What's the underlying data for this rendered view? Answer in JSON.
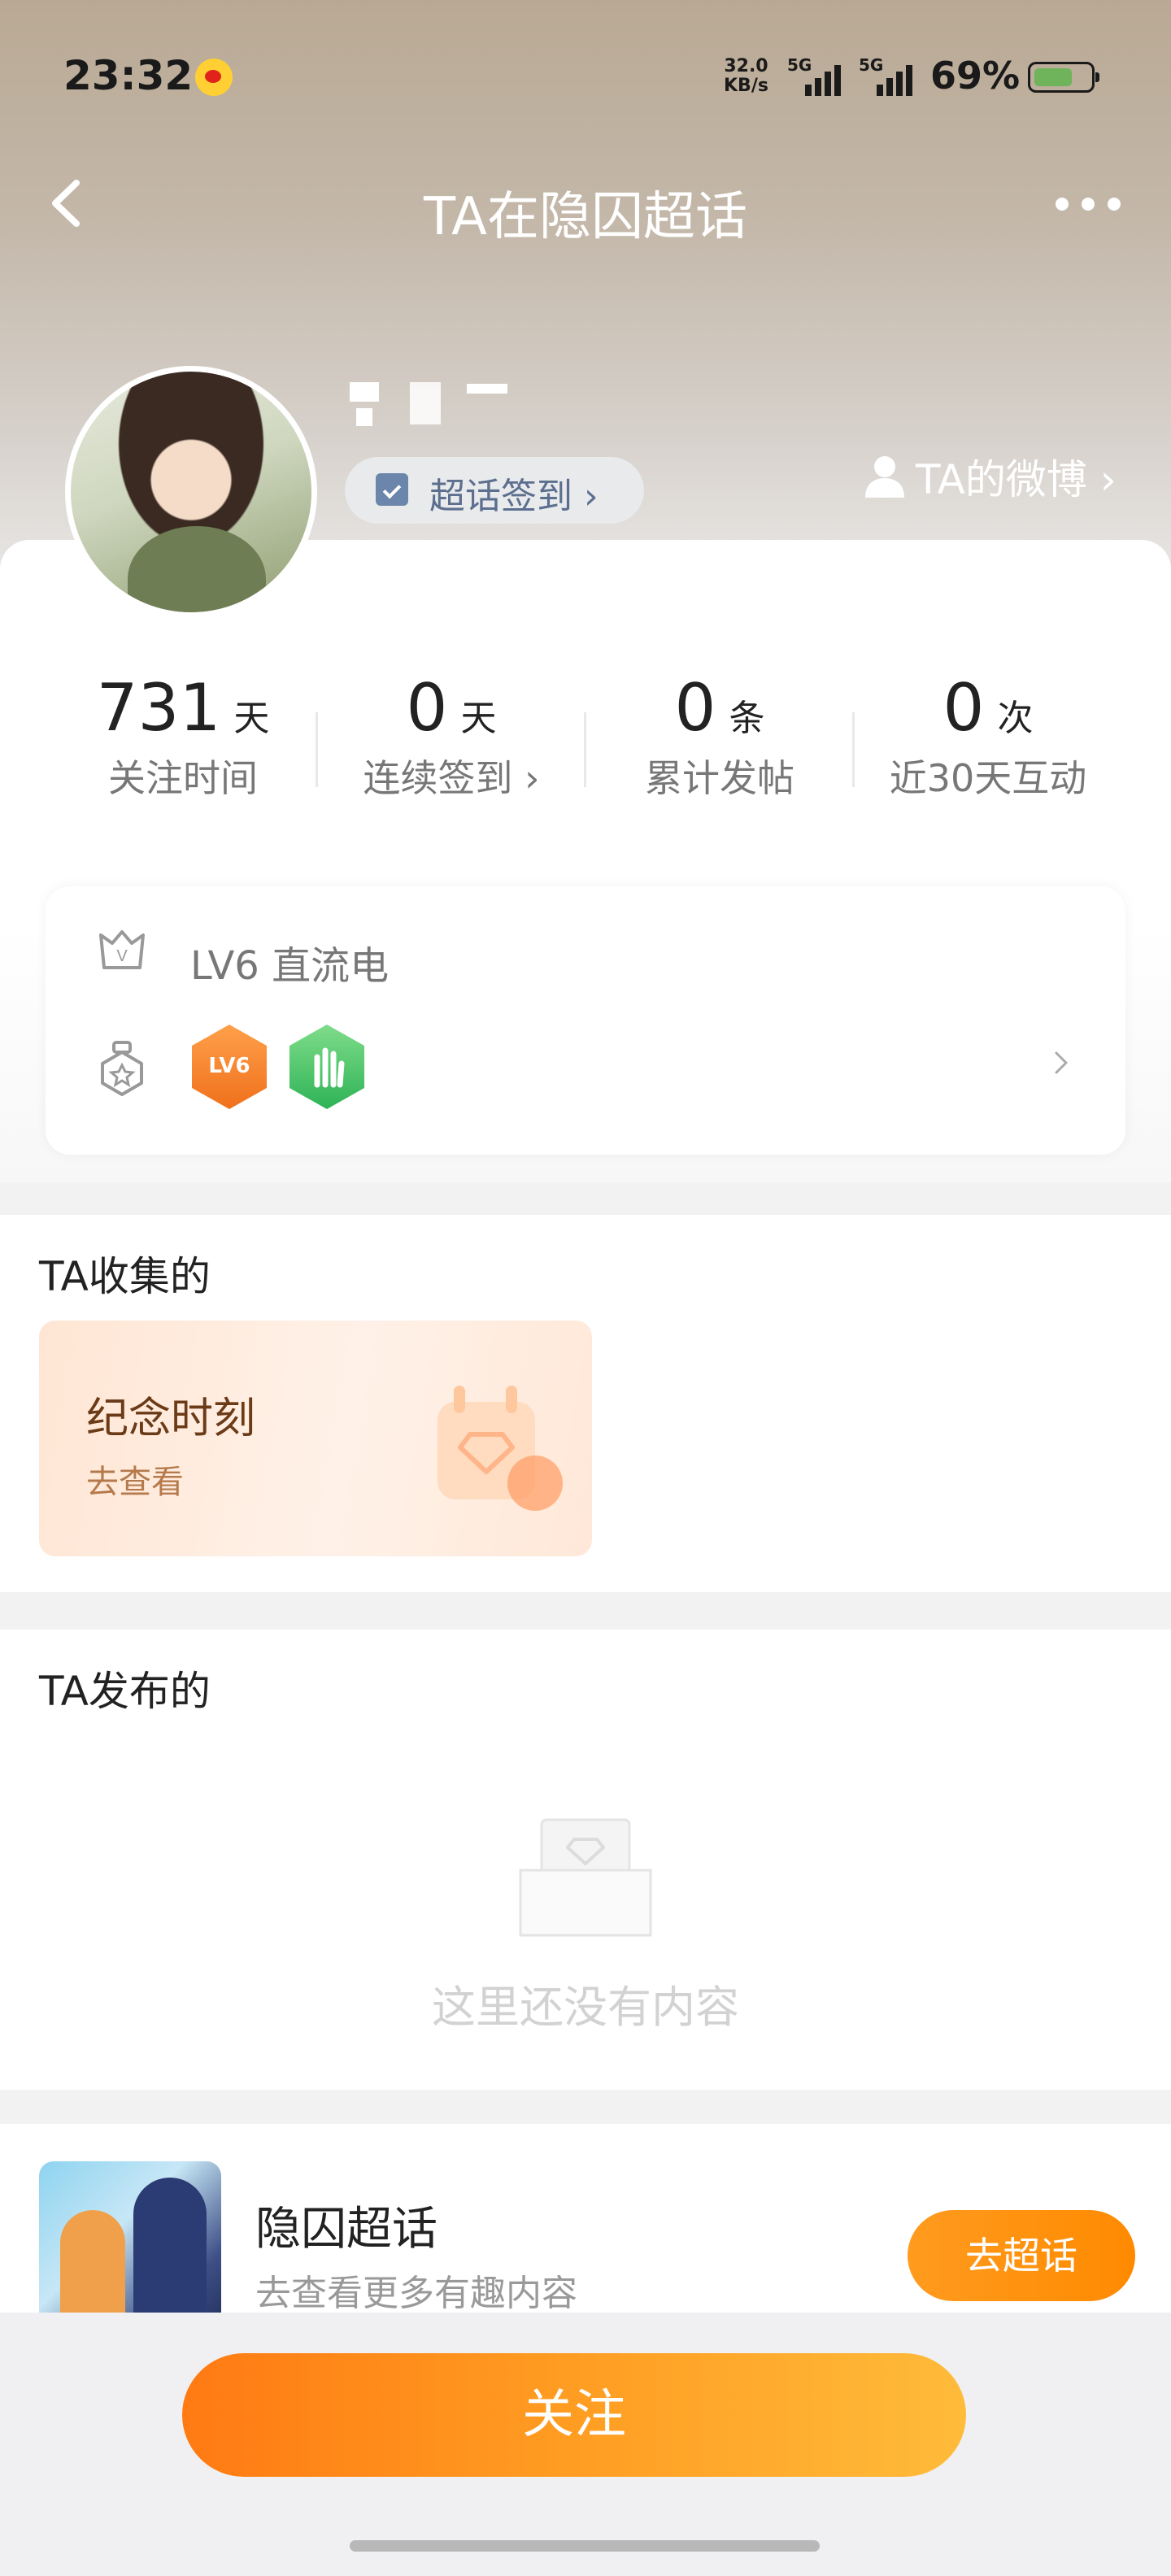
{
  "status_bar": {
    "time": "23:32",
    "net_speed_value": "32.0",
    "net_speed_unit": "KB/s",
    "signal1_label": "5G",
    "signal2_label": "5G",
    "battery_pct": "69%",
    "battery_level": 0.69,
    "app_icon": "weibo-icon"
  },
  "nav": {
    "title": "TA在隐囚超话",
    "back_icon": "chevron-left-icon",
    "more_icon": "more-dots-icon"
  },
  "profile": {
    "checkin_label": "超话签到 ›",
    "weibo_link_label": "TA的微博 ›"
  },
  "stats": [
    {
      "num": "731",
      "unit": "天",
      "label": "关注时间"
    },
    {
      "num": "0",
      "unit": "天",
      "label": "连续签到 ›"
    },
    {
      "num": "0",
      "unit": "条",
      "label": "累计发帖"
    },
    {
      "num": "0",
      "unit": "次",
      "label": "近30天互动"
    }
  ],
  "level": {
    "label": "LV6 直流电",
    "badge1_text": "LV6"
  },
  "collected": {
    "title": "TA收集的",
    "card_title": "纪念时刻",
    "card_sub": "去查看"
  },
  "posted": {
    "title": "TA发布的",
    "empty_text": "这里还没有内容"
  },
  "topic": {
    "name": "隐囚超话",
    "subtitle": "去查看更多有趣内容",
    "button": "去超话"
  },
  "bottom": {
    "follow_button": "关注"
  },
  "colors": {
    "accent": "#ff8a00",
    "link_blue": "#5c6f8f"
  }
}
